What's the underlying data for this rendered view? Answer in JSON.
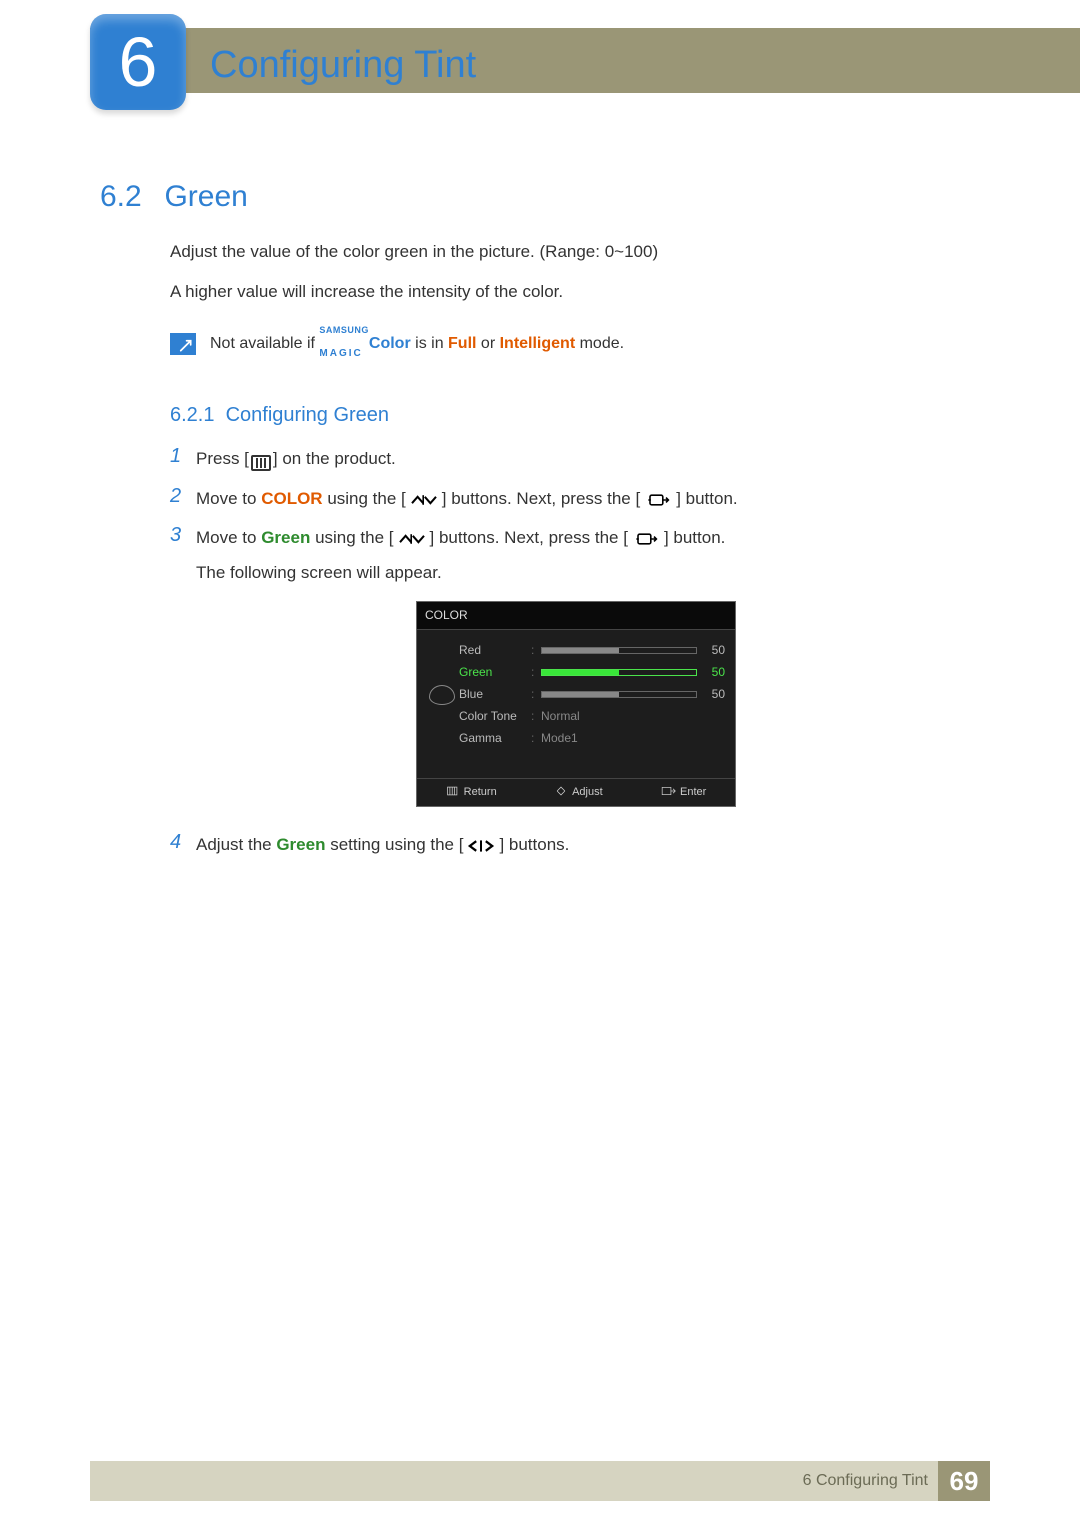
{
  "chapter": {
    "number": "6",
    "title": "Configuring Tint"
  },
  "section": {
    "number": "6.2",
    "title": "Green"
  },
  "paragraphs": {
    "p1": "Adjust the value of the color green in the picture. (Range: 0~100)",
    "p2": "A higher value will increase the intensity of the color."
  },
  "note": {
    "prefix": "Not available if ",
    "brand_top": "SAMSUNG",
    "brand_bottom": "MAGIC",
    "colorword": "Color",
    "mid": " is in ",
    "full": "Full",
    "or": " or ",
    "intelligent": "Intelligent",
    "suffix": " mode."
  },
  "subsection": {
    "number": "6.2.1",
    "title": "Configuring Green"
  },
  "steps": {
    "s1": {
      "num": "1",
      "a": "Press [",
      "b": "] on the product."
    },
    "s2": {
      "num": "2",
      "a": "Move to ",
      "color": "COLOR",
      "b": " using the [",
      "c": "] buttons. Next, press the [",
      "d": "] button."
    },
    "s3": {
      "num": "3",
      "a": "Move to ",
      "green": "Green",
      "b": " using the [",
      "c": "] buttons. Next, press the [",
      "d": "] button.",
      "e": "The following screen will appear."
    },
    "s4": {
      "num": "4",
      "a": "Adjust the ",
      "green": "Green",
      "b": " setting using the [",
      "c": "] buttons."
    }
  },
  "osd": {
    "title": "COLOR",
    "rows": [
      {
        "label": "Red",
        "value": "50",
        "fill_pct": 50,
        "fill_color": "#888"
      },
      {
        "label": "Green",
        "value": "50",
        "fill_pct": 50,
        "fill_color": "#39e639",
        "active": true
      },
      {
        "label": "Blue",
        "value": "50",
        "fill_pct": 50,
        "fill_color": "#888"
      },
      {
        "label": "Color Tone",
        "text": "Normal"
      },
      {
        "label": "Gamma",
        "text": "Mode1"
      }
    ],
    "footer": {
      "return": "Return",
      "adjust": "Adjust",
      "enter": "Enter"
    }
  },
  "footer": {
    "label": "6 Configuring Tint",
    "page": "69"
  }
}
